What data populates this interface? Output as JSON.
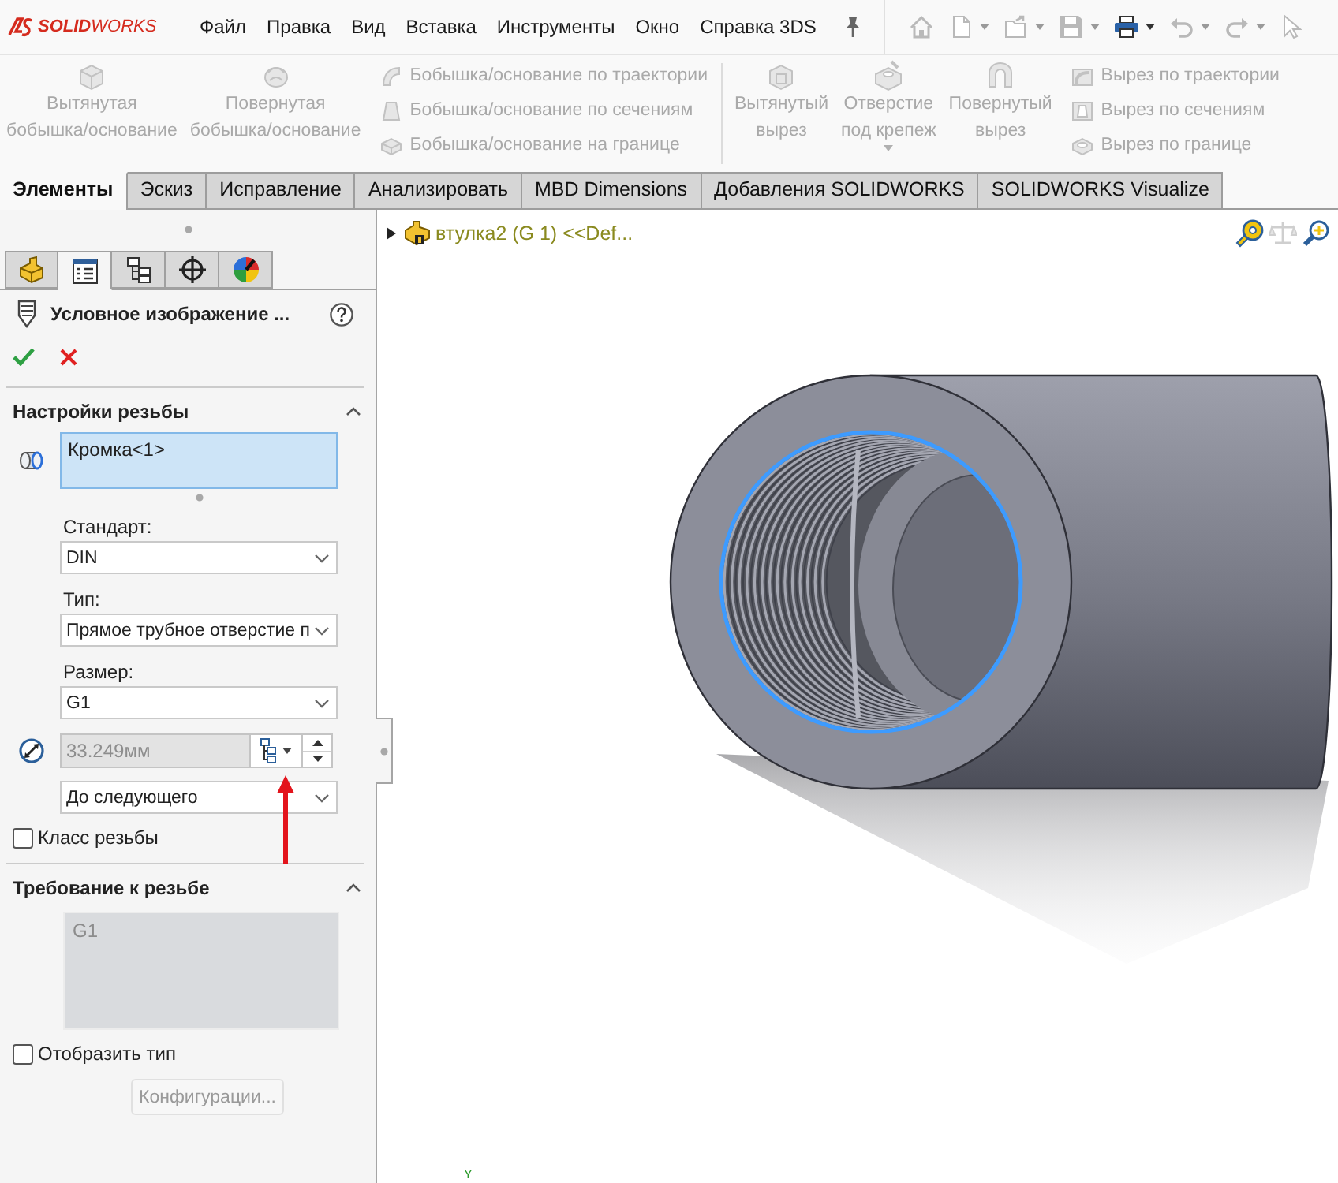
{
  "logo": {
    "text": "**SOLID**WORKS"
  },
  "menu": [
    "Файл",
    "Правка",
    "Вид",
    "Вставка",
    "Инструменты",
    "Окно",
    "Справка 3DS"
  ],
  "quick_access": [
    {
      "kind": "home",
      "disabled": true,
      "dropdown": false
    },
    {
      "kind": "new",
      "disabled": true,
      "dropdown": true
    },
    {
      "kind": "open",
      "disabled": true,
      "dropdown": true
    },
    {
      "kind": "save",
      "disabled": true,
      "dropdown": true
    },
    {
      "kind": "print",
      "disabled": false,
      "dropdown": true
    },
    {
      "kind": "undo",
      "disabled": true,
      "dropdown": true
    },
    {
      "kind": "redo",
      "disabled": true,
      "dropdown": true
    },
    {
      "kind": "select",
      "disabled": true,
      "dropdown": false
    }
  ],
  "ribbon": {
    "groups": [
      {
        "large": [
          {
            "kind": "extrude",
            "label": "Вытянутая\nбобышка/основание",
            "disabled": true,
            "dropdown": false
          },
          {
            "kind": "revolve",
            "label": "Повернутая\nбобышка/основание",
            "disabled": true,
            "dropdown": false
          }
        ],
        "small": [
          {
            "kind": "sweep",
            "label": "Бобышка/основание по траектории",
            "disabled": true
          },
          {
            "kind": "loft",
            "label": "Бобышка/основание по сечениям",
            "disabled": true
          },
          {
            "kind": "boundary",
            "label": "Бобышка/основание на границе",
            "disabled": true
          }
        ]
      },
      {
        "large": [
          {
            "kind": "extrude-cut",
            "label": "Вытянутый\nвырез",
            "disabled": true,
            "dropdown": false
          },
          {
            "kind": "hole",
            "label": "Отверстие\nпод крепеж",
            "disabled": true,
            "dropdown": true
          },
          {
            "kind": "revolve-cut",
            "label": "Повернутый\nвырез",
            "disabled": true,
            "dropdown": false
          }
        ],
        "small": [
          {
            "kind": "sweep-cut",
            "label": "Вырез по траектории",
            "disabled": true
          },
          {
            "kind": "loft-cut",
            "label": "Вырез по сечениям",
            "disabled": true
          },
          {
            "kind": "boundary-cut",
            "label": "Вырез по границе",
            "disabled": true
          }
        ]
      }
    ]
  },
  "tabs": [
    {
      "label": "Элементы",
      "selected": true
    },
    {
      "label": "Эскиз",
      "selected": false
    },
    {
      "label": "Исправление",
      "selected": false
    },
    {
      "label": "Анализировать",
      "selected": false
    },
    {
      "label": "MBD Dimensions",
      "selected": false
    },
    {
      "label": "Добавления SOLIDWORKS",
      "selected": false
    },
    {
      "label": "SOLIDWORKS Visualize",
      "selected": false
    }
  ],
  "property_manager": {
    "tabs": [
      {
        "kind": "feature-tree",
        "selected": false
      },
      {
        "kind": "property",
        "selected": true
      },
      {
        "kind": "configuration",
        "selected": false
      },
      {
        "kind": "dimxpert",
        "selected": false
      },
      {
        "kind": "display",
        "selected": false
      }
    ],
    "title": "Условное изображение ...",
    "thread_settings": {
      "title": "Настройки резьбы",
      "expanded": true,
      "selection": "Кромка<1>",
      "standard": {
        "label": "Стандарт:",
        "value": "DIN"
      },
      "type": {
        "label": "Тип:",
        "value": "Прямое трубное отверстие п"
      },
      "size": {
        "label": "Размер:",
        "value": "G1"
      },
      "diameter": {
        "value": "33.249мм",
        "disabled": true
      },
      "end_condition": {
        "value": "До следующего"
      },
      "thread_class": {
        "label": "Класс резьбы",
        "checked": false
      }
    },
    "thread_callout": {
      "title": "Требование к резьбе",
      "expanded": true,
      "value": "G1",
      "disabled": true,
      "show_type": {
        "label": "Отобразить тип",
        "checked": false
      },
      "button": {
        "label": "Конфигурации...",
        "disabled": true
      }
    }
  },
  "viewport": {
    "breadcrumb": "втулка2 (G 1) <<Def...",
    "tools": [
      {
        "kind": "measure",
        "disabled": false
      },
      {
        "kind": "mass",
        "disabled": true
      },
      {
        "kind": "zoom",
        "disabled": false
      }
    ],
    "axis_label": "Y"
  }
}
